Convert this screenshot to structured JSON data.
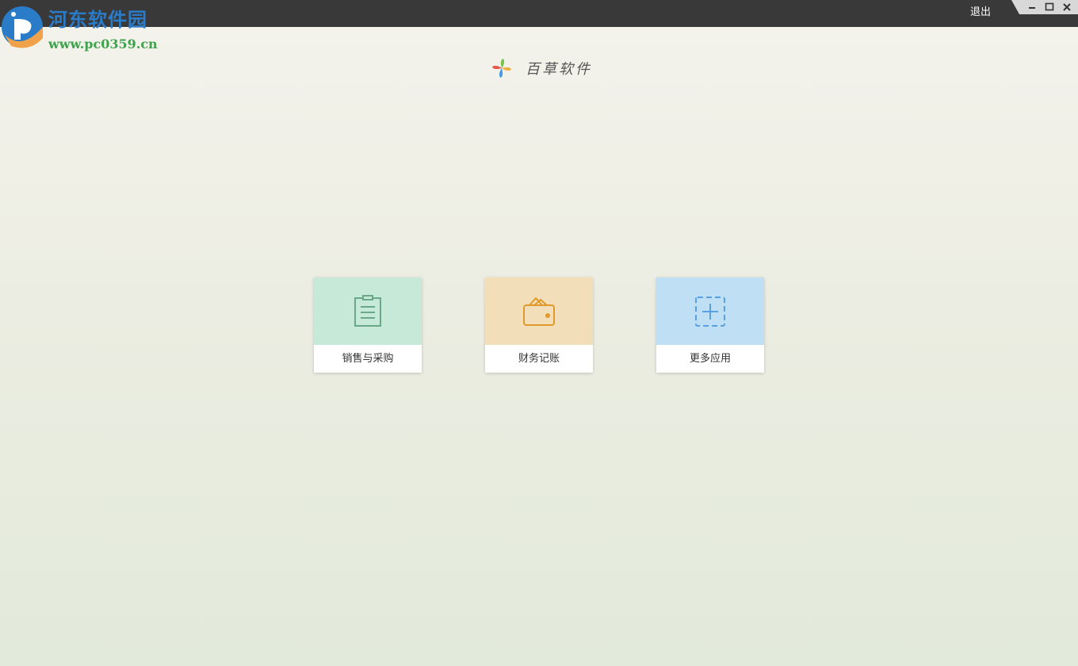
{
  "topbar": {
    "logout_label": "退出",
    "background": "#393939"
  },
  "window_controls": [
    {
      "name": "minimize",
      "icon": "minimize-icon"
    },
    {
      "name": "maximize",
      "icon": "maximize-icon"
    },
    {
      "name": "close",
      "icon": "close-icon"
    }
  ],
  "watermark": {
    "title": "河东软件园",
    "url": "www.pc0359.cn",
    "title_color": "#2a7cc9",
    "url_color": "#3fa34d"
  },
  "brand": {
    "name": "百草软件",
    "icon": "pinwheel-logo-icon"
  },
  "apps": [
    {
      "label": "销售与采购",
      "icon": "clipboard-icon",
      "color": "#c6e9d8",
      "icon_color": "#6aa889"
    },
    {
      "label": "财务记账",
      "icon": "wallet-icon",
      "color": "#f2dfb9",
      "icon_color": "#e09a2c"
    },
    {
      "label": "更多应用",
      "icon": "add-square-icon",
      "color": "#bfdff4",
      "icon_color": "#5aa0e0"
    }
  ]
}
